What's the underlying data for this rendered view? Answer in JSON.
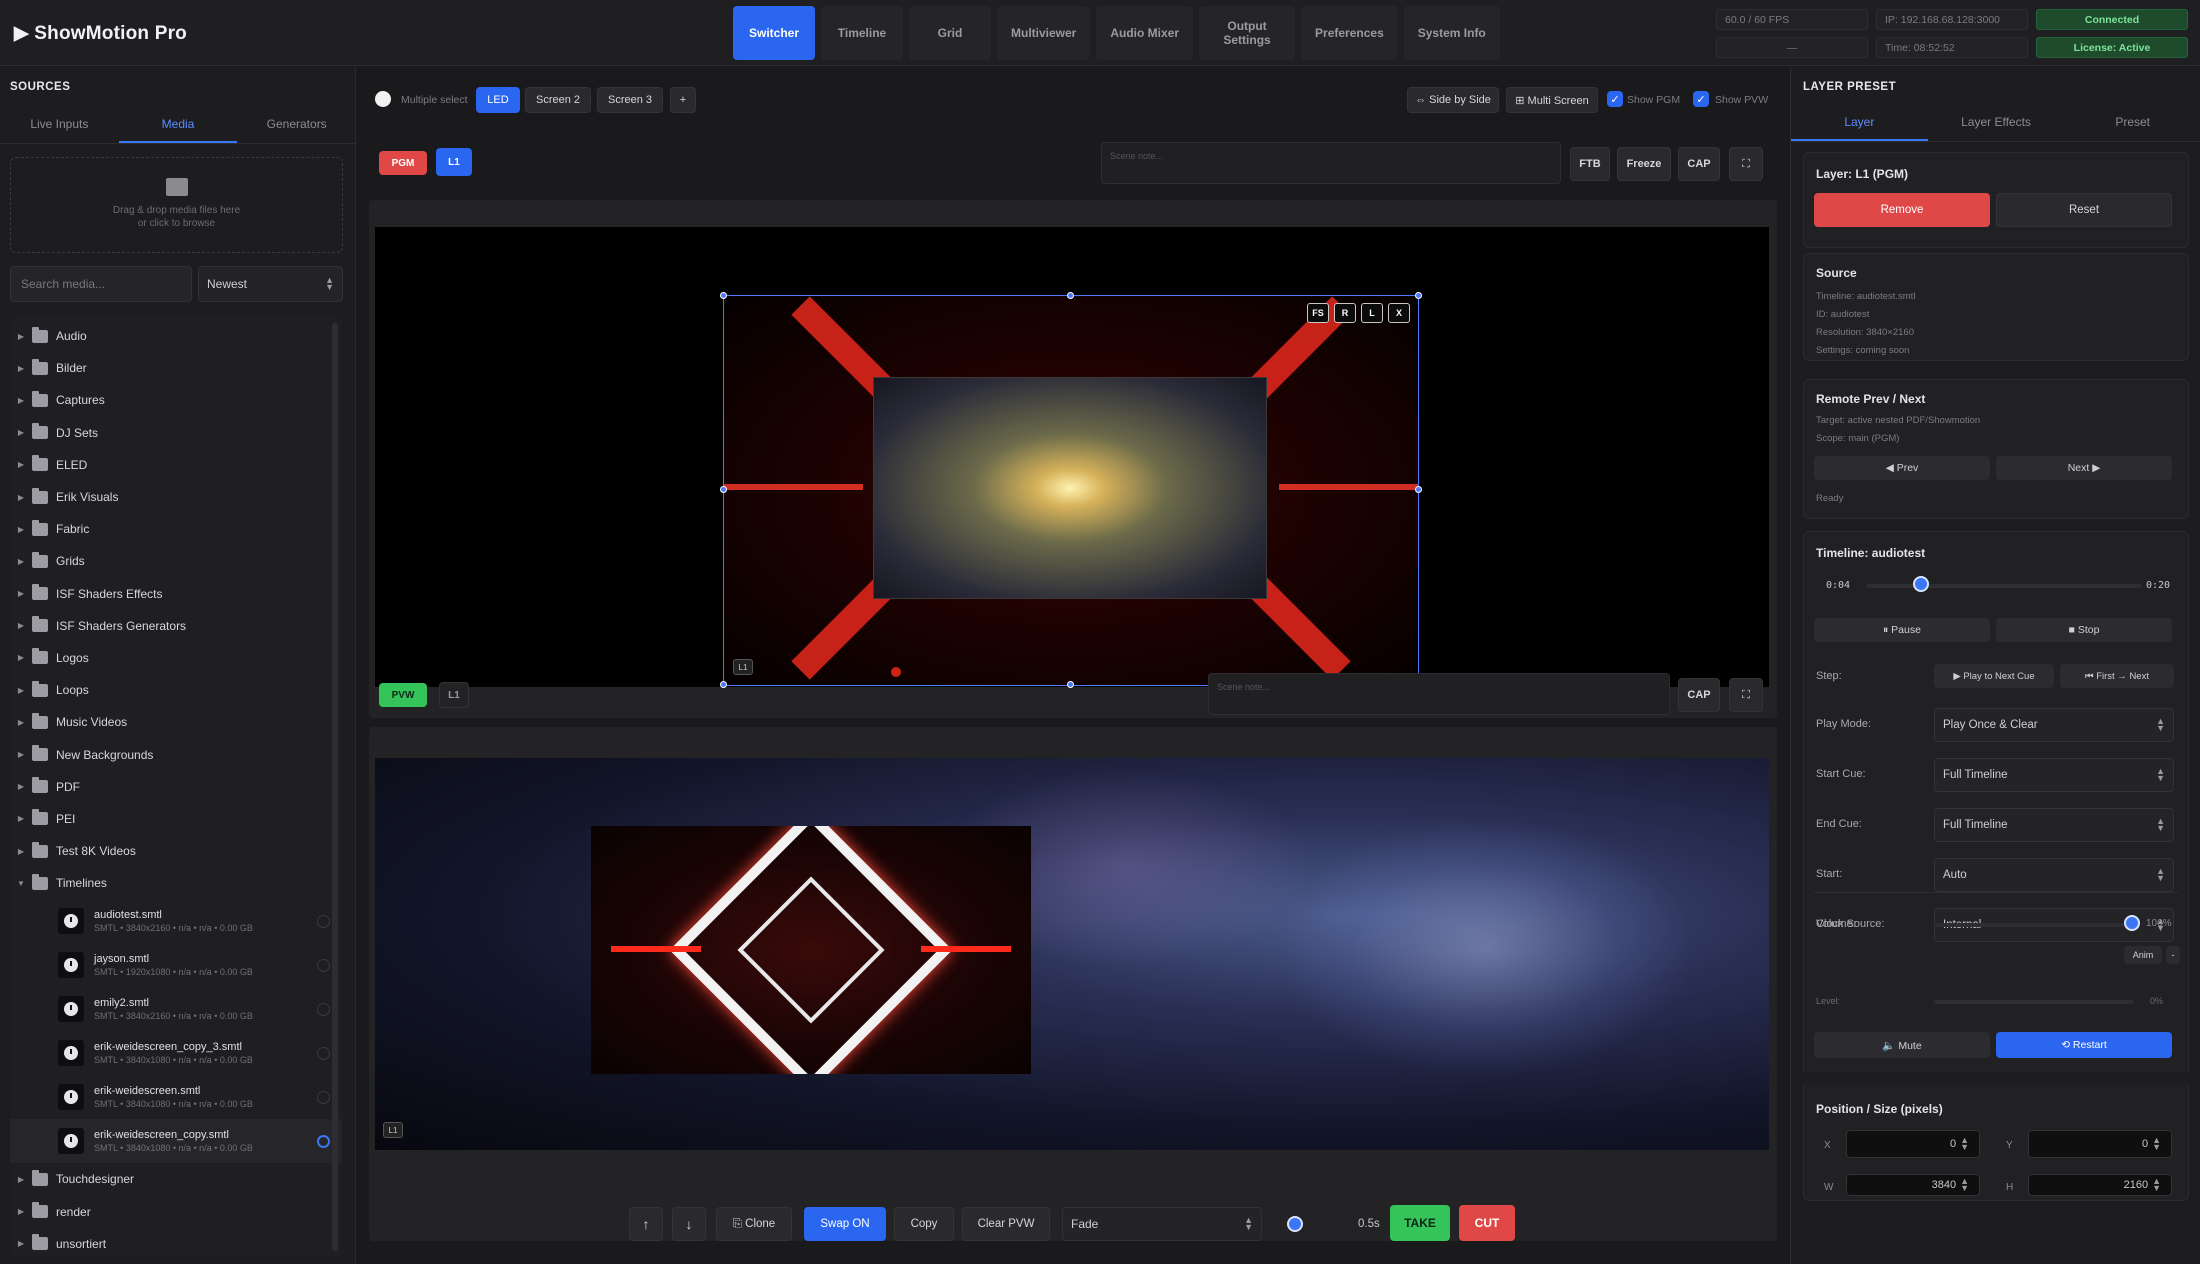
{
  "app": {
    "title": "ShowMotion Pro"
  },
  "nav": {
    "tabs": [
      {
        "label": "Switcher"
      },
      {
        "label": "Timeline"
      },
      {
        "label": "Grid"
      },
      {
        "label": "Multiviewer"
      },
      {
        "label": "Audio Mixer"
      },
      {
        "label": "Output Settings"
      },
      {
        "label": "Preferences"
      },
      {
        "label": "System Info"
      }
    ]
  },
  "status": {
    "fps": "60.0 / 60 FPS",
    "ip": "IP: 192.168.68.128:3000",
    "connection": "Connected",
    "dash": "—",
    "time": "Time: 08:52:52",
    "license": "License: Active"
  },
  "sources": {
    "title": "SOURCES",
    "tabs": [
      "Live Inputs",
      "Media",
      "Generators"
    ],
    "drop_line1": "Drag & drop media files here",
    "drop_line2": "or click to browse",
    "search_placeholder": "Search media...",
    "sort": "Newest",
    "folders_a": [
      "Audio",
      "Bilder",
      "Captures",
      "DJ Sets",
      "ELED",
      "Erik Visuals",
      "Fabric",
      "Grids",
      "ISF Shaders Effects",
      "ISF Shaders Generators",
      "Logos",
      "Loops",
      "Music Videos",
      "New Backgrounds",
      "PDF",
      "PEI",
      "Test 8K Videos",
      "Timelines"
    ],
    "files": [
      {
        "name": "audiotest.smtl",
        "meta": "SMTL • 3840x2160 • n/a • n/a • 0.00 GB"
      },
      {
        "name": "jayson.smtl",
        "meta": "SMTL • 1920x1080 • n/a • n/a • 0.00 GB"
      },
      {
        "name": "emily2.smtl",
        "meta": "SMTL • 3840x2160 • n/a • n/a • 0.00 GB"
      },
      {
        "name": "erik-weidescreen_copy_3.smtl",
        "meta": "SMTL • 3840x1080 • n/a • n/a • 0.00 GB"
      },
      {
        "name": "erik-weidescreen.smtl",
        "meta": "SMTL • 3840x1080 • n/a • n/a • 0.00 GB"
      },
      {
        "name": "erik-weidescreen_copy.smtl",
        "meta": "SMTL • 3840x1080 • n/a • n/a • 0.00 GB"
      }
    ],
    "folders_b": [
      "Touchdesigner",
      "render",
      "unsortiert"
    ]
  },
  "toolbar": {
    "multiple_select": "Multiple select",
    "screens": [
      "LED",
      "Screen 2",
      "Screen 3",
      "+"
    ],
    "side_by_side": "⇔ Side by Side",
    "multi_screen": "⊞ Multi Screen",
    "show_pgm": "Show PGM",
    "show_pvw": "Show PVW"
  },
  "pgm": {
    "badge": "PGM",
    "layer": "L1",
    "note_placeholder": "Scene note...",
    "ftb": "FTB",
    "freeze": "Freeze",
    "cap": "CAP",
    "fullscreen": "⛶",
    "mini": [
      "FS",
      "R",
      "L",
      "X"
    ],
    "tag": "L1"
  },
  "pvw": {
    "badge": "PVW",
    "layer": "L1",
    "note_placeholder": "Scene note...",
    "cap": "CAP",
    "fullscreen": "⛶",
    "tag": "L1"
  },
  "bottom": {
    "up": "↑",
    "down": "↓",
    "clone": "⎘ Clone",
    "swap": "Swap ON",
    "copy": "Copy",
    "clear": "Clear PVW",
    "transition": "Fade",
    "duration": "0.5s",
    "take": "TAKE",
    "cut": "CUT"
  },
  "layer": {
    "title": "LAYER PRESET",
    "tabs": [
      "Layer",
      "Layer Effects",
      "Preset"
    ],
    "layer_name": "Layer: L1 (PGM)",
    "remove": "Remove",
    "reset": "Reset",
    "source": {
      "title": "Source",
      "lines": [
        "Timeline: audiotest.smtl",
        "ID: audiotest",
        "Resolution: 3840×2160",
        "Settings: coming soon"
      ]
    },
    "remote": {
      "title": "Remote Prev / Next",
      "lines": [
        "Target: active nested PDF/Showmotion",
        "Scope: main (PGM)"
      ],
      "prev": "◀ Prev",
      "next": "Next ▶",
      "state": "Ready"
    },
    "timeline": {
      "title": "Timeline: audiotest",
      "start": "0:04",
      "end": "0:20",
      "progress": 0.2,
      "pause": "⏸ Pause",
      "stop": "■ Stop",
      "step_label": "Step:",
      "step_a": "▶ Play to Next Cue",
      "step_b": "⏮ First → Next",
      "fields": [
        {
          "label": "Play Mode:",
          "value": "Play Once & Clear"
        },
        {
          "label": "Start Cue:",
          "value": "Full Timeline"
        },
        {
          "label": "End Cue:",
          "value": "Full Timeline"
        },
        {
          "label": "Start:",
          "value": "Auto"
        },
        {
          "label": "Clock Source:",
          "value": "Internal"
        }
      ],
      "volume_label": "Volume:",
      "volume_value": "100%",
      "anim": "Anim",
      "minus": "-",
      "level_label": "Level:",
      "level_value": "0%",
      "mute": "🔈 Mute",
      "restart": "⟲ Restart"
    },
    "position": {
      "title": "Position / Size (pixels)",
      "x_label": "X",
      "x": "0",
      "y_label": "Y",
      "y": "0",
      "w_label": "W",
      "w": "3840",
      "h_label": "H",
      "h": "2160"
    }
  },
  "colors": {
    "accent": "#2a66f0",
    "pgm": "#e04848",
    "pvw": "#35c45a"
  }
}
